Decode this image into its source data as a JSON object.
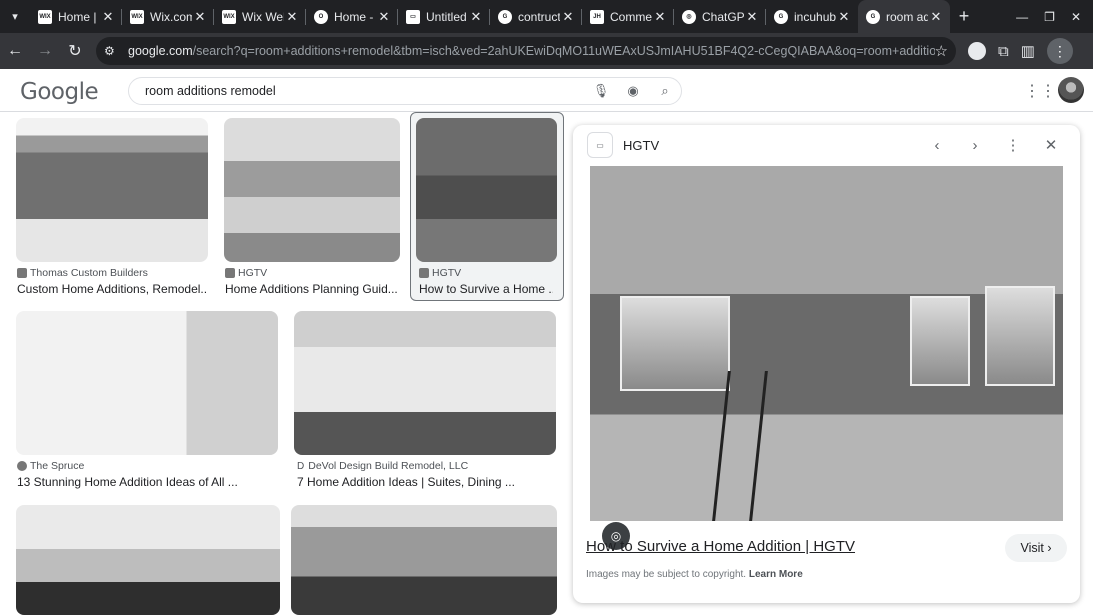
{
  "browser": {
    "tabs": [
      {
        "title": "Home |",
        "fav": "WIX"
      },
      {
        "title": "Wix.com",
        "fav": "WIX"
      },
      {
        "title": "Wix Web",
        "fav": "WIX"
      },
      {
        "title": "Home -",
        "fav": "O"
      },
      {
        "title": "Untitled",
        "fav": "▭"
      },
      {
        "title": "contruct",
        "fav": "G"
      },
      {
        "title": "Comme",
        "fav": "JH"
      },
      {
        "title": "ChatGP",
        "fav": "◎"
      },
      {
        "title": "incuhub",
        "fav": "G"
      },
      {
        "title": "room ad",
        "fav": "G"
      }
    ],
    "url_host": "google.com",
    "url_rest": "/search?q=room+additions+remodel&tbm=isch&ved=2ahUKEwiDqMO11uWEAxUSJmIAHU51BF4Q2-cCegQIABAA&oq=room+additions+remodel&..."
  },
  "search": {
    "logo": "Google",
    "query": "room additions remodel"
  },
  "results": [
    {
      "source": "Thomas Custom Builders",
      "caption": "Custom Home Additions, Remodel..."
    },
    {
      "source": "HGTV",
      "caption": "Home Additions Planning Guid..."
    },
    {
      "source": "HGTV",
      "caption": "How to Survive a Home ..."
    },
    {
      "source": "The Spruce",
      "caption": "13 Stunning Home Addition Ideas of All ..."
    },
    {
      "source": "DeVol Design Build Remodel, LLC",
      "caption": "7 Home Addition Ideas | Suites, Dining ..."
    },
    {
      "source": "",
      "caption": ""
    },
    {
      "source": "",
      "caption": ""
    }
  ],
  "preview": {
    "site": "HGTV",
    "title": "How to Survive a Home Addition | HGTV",
    "visit_label": "Visit",
    "copyright_text": "Images may be subject to copyright.",
    "learn_more": "Learn More"
  }
}
